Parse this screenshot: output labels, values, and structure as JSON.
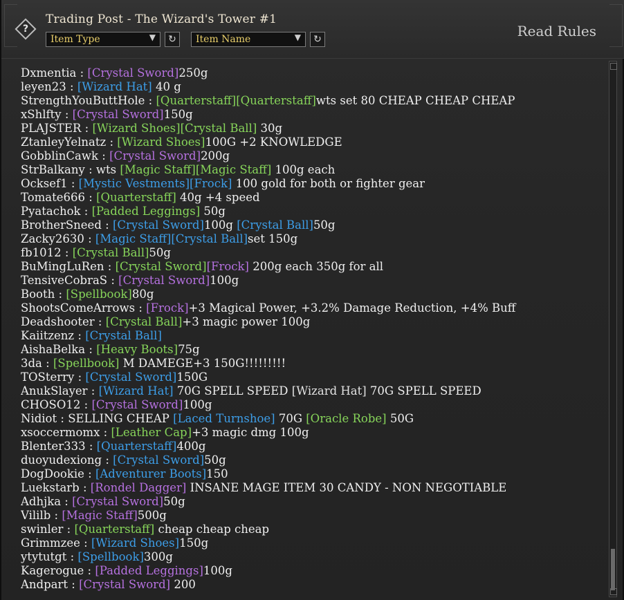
{
  "header": {
    "help_label": "?",
    "title": "Trading Post - The Wizard's Tower #1",
    "item_type_label": "Item Type",
    "item_name_label": "Item Name",
    "refresh_glyph": "↻",
    "read_rules_label": "Read Rules"
  },
  "messages": [
    {
      "segments": [
        {
          "t": "Dxmentia",
          "c": "text"
        },
        {
          "t": " : ",
          "c": "sep"
        },
        {
          "t": "[Crystal Sword]",
          "c": "epic"
        },
        {
          "t": "250g",
          "c": "text"
        }
      ]
    },
    {
      "segments": [
        {
          "t": "leyen23",
          "c": "text"
        },
        {
          "t": " : ",
          "c": "sep"
        },
        {
          "t": "[Wizard Hat]",
          "c": "rare"
        },
        {
          "t": " 40 g",
          "c": "text"
        }
      ]
    },
    {
      "segments": [
        {
          "t": "StrengthYouButtHole",
          "c": "text"
        },
        {
          "t": " : ",
          "c": "sep"
        },
        {
          "t": "[Quarterstaff][Quarterstaff]",
          "c": "uncommon"
        },
        {
          "t": "wts set 80 CHEAP CHEAP CHEAP",
          "c": "text"
        }
      ]
    },
    {
      "segments": [
        {
          "t": "xShlfty",
          "c": "text"
        },
        {
          "t": " : ",
          "c": "sep"
        },
        {
          "t": "[Crystal Sword]",
          "c": "epic"
        },
        {
          "t": "150g",
          "c": "text"
        }
      ]
    },
    {
      "segments": [
        {
          "t": "PLAJSTER",
          "c": "text"
        },
        {
          "t": " : ",
          "c": "sep"
        },
        {
          "t": "[Wizard Shoes]",
          "c": "uncommon"
        },
        {
          "t": "[Crystal Ball]",
          "c": "uncommon"
        },
        {
          "t": " 30g",
          "c": "text"
        }
      ]
    },
    {
      "segments": [
        {
          "t": "ZtanleyYelnatz",
          "c": "text"
        },
        {
          "t": " : ",
          "c": "sep"
        },
        {
          "t": "[Wizard Shoes]",
          "c": "uncommon"
        },
        {
          "t": "100G +2 KNOWLEDGE",
          "c": "text"
        }
      ]
    },
    {
      "segments": [
        {
          "t": "GobblinCawk",
          "c": "text"
        },
        {
          "t": " : ",
          "c": "sep"
        },
        {
          "t": "[Crystal Sword]",
          "c": "epic"
        },
        {
          "t": "200g",
          "c": "text"
        }
      ]
    },
    {
      "segments": [
        {
          "t": "StrBalkany",
          "c": "text"
        },
        {
          "t": " : ",
          "c": "sep"
        },
        {
          "t": "wts ",
          "c": "text"
        },
        {
          "t": "[Magic Staff]",
          "c": "uncommon"
        },
        {
          "t": "[Magic Staff]",
          "c": "uncommon"
        },
        {
          "t": " 100g each",
          "c": "text"
        }
      ]
    },
    {
      "segments": [
        {
          "t": "Ocksef1",
          "c": "text"
        },
        {
          "t": " : ",
          "c": "sep"
        },
        {
          "t": "[Mystic Vestments]",
          "c": "rare"
        },
        {
          "t": "[Frock]",
          "c": "rare"
        },
        {
          "t": " 100 gold for both or fighter gear",
          "c": "text"
        }
      ]
    },
    {
      "segments": [
        {
          "t": "Tomate666",
          "c": "text"
        },
        {
          "t": " : ",
          "c": "sep"
        },
        {
          "t": "[Quarterstaff]",
          "c": "uncommon"
        },
        {
          "t": " 40g +4 speed",
          "c": "text"
        }
      ]
    },
    {
      "segments": [
        {
          "t": "Pyatachok",
          "c": "text"
        },
        {
          "t": " : ",
          "c": "sep"
        },
        {
          "t": "[Padded Leggings]",
          "c": "uncommon"
        },
        {
          "t": " 50g",
          "c": "text"
        }
      ]
    },
    {
      "segments": [
        {
          "t": "BrotherSneed",
          "c": "text"
        },
        {
          "t": " : ",
          "c": "sep"
        },
        {
          "t": "[Crystal Sword]",
          "c": "rare"
        },
        {
          "t": "100g ",
          "c": "text"
        },
        {
          "t": "[Crystal Ball]",
          "c": "rare"
        },
        {
          "t": "50g",
          "c": "text"
        }
      ]
    },
    {
      "segments": [
        {
          "t": "Zacky2630",
          "c": "text"
        },
        {
          "t": " : ",
          "c": "sep"
        },
        {
          "t": "[Magic Staff]",
          "c": "rare"
        },
        {
          "t": "[Crystal Ball]",
          "c": "rare"
        },
        {
          "t": "set 150g",
          "c": "text"
        }
      ]
    },
    {
      "segments": [
        {
          "t": "fb1012",
          "c": "text"
        },
        {
          "t": " : ",
          "c": "sep"
        },
        {
          "t": "[Crystal Ball]",
          "c": "uncommon"
        },
        {
          "t": "50g",
          "c": "text"
        }
      ]
    },
    {
      "segments": [
        {
          "t": "BuMingLuRen",
          "c": "text"
        },
        {
          "t": " : ",
          "c": "sep"
        },
        {
          "t": "[Crystal Sword]",
          "c": "uncommon"
        },
        {
          "t": "[Frock]",
          "c": "epic"
        },
        {
          "t": " 200g each 350g for all",
          "c": "text"
        }
      ]
    },
    {
      "segments": [
        {
          "t": "TensiveCobraS",
          "c": "text"
        },
        {
          "t": " : ",
          "c": "sep"
        },
        {
          "t": "[Crystal Sword]",
          "c": "epic"
        },
        {
          "t": "100g",
          "c": "text"
        }
      ]
    },
    {
      "segments": [
        {
          "t": "Booth",
          "c": "text"
        },
        {
          "t": " : ",
          "c": "sep"
        },
        {
          "t": "[Spellbook]",
          "c": "uncommon"
        },
        {
          "t": "80g",
          "c": "text"
        }
      ]
    },
    {
      "segments": [
        {
          "t": "ShootsComeArrows",
          "c": "text"
        },
        {
          "t": " : ",
          "c": "sep"
        },
        {
          "t": "[Frock]",
          "c": "epic"
        },
        {
          "t": "+3 Magical Power, +3.2% Damage Reduction, +4% Buff",
          "c": "text"
        }
      ]
    },
    {
      "segments": [
        {
          "t": "Deadshooter",
          "c": "text"
        },
        {
          "t": " : ",
          "c": "sep"
        },
        {
          "t": "[Crystal Ball]",
          "c": "uncommon"
        },
        {
          "t": "+3 magic power 100g",
          "c": "text"
        }
      ]
    },
    {
      "segments": [
        {
          "t": "Kaiitzenz",
          "c": "text"
        },
        {
          "t": " : ",
          "c": "sep"
        },
        {
          "t": "                            ",
          "c": "text"
        },
        {
          "t": "[Crystal Ball]",
          "c": "rare"
        }
      ]
    },
    {
      "segments": [
        {
          "t": "AishaBelka",
          "c": "text"
        },
        {
          "t": " : ",
          "c": "sep"
        },
        {
          "t": "[Heavy Boots]",
          "c": "uncommon"
        },
        {
          "t": "75g",
          "c": "text"
        }
      ]
    },
    {
      "segments": [
        {
          "t": "3da",
          "c": "text"
        },
        {
          "t": " : ",
          "c": "sep"
        },
        {
          "t": "[Spellbook]",
          "c": "uncommon"
        },
        {
          "t": " M DAMEGE+3    150G!!!!!!!!!",
          "c": "text"
        }
      ]
    },
    {
      "segments": [
        {
          "t": "TOSterry",
          "c": "text"
        },
        {
          "t": " : ",
          "c": "sep"
        },
        {
          "t": "[Crystal Sword]",
          "c": "rare"
        },
        {
          "t": "150G",
          "c": "text"
        }
      ]
    },
    {
      "segments": [
        {
          "t": "AnukSlayer",
          "c": "text"
        },
        {
          "t": " : ",
          "c": "sep"
        },
        {
          "t": "[Wizard Hat]",
          "c": "rare"
        },
        {
          "t": " 70G SPELL SPEED ",
          "c": "text"
        },
        {
          "t": "[Wizard Hat]",
          "c": "common"
        },
        {
          "t": " 70G SPELL SPEED",
          "c": "text"
        }
      ]
    },
    {
      "segments": [
        {
          "t": "CHOSO12",
          "c": "text"
        },
        {
          "t": " : ",
          "c": "sep"
        },
        {
          "t": "[Crystal Sword]",
          "c": "epic"
        },
        {
          "t": "100g",
          "c": "text"
        }
      ]
    },
    {
      "segments": [
        {
          "t": "Nidiot",
          "c": "text"
        },
        {
          "t": " : ",
          "c": "sep"
        },
        {
          "t": "                    SELLING CHEAP ",
          "c": "text"
        },
        {
          "t": "[Laced Turnshoe]",
          "c": "rare"
        },
        {
          "t": " 70G ",
          "c": "text"
        },
        {
          "t": "[Oracle Robe]",
          "c": "uncommon"
        },
        {
          "t": " 50G",
          "c": "text"
        }
      ]
    },
    {
      "segments": [
        {
          "t": "xsoccermomx",
          "c": "text"
        },
        {
          "t": " : ",
          "c": "sep"
        },
        {
          "t": "[Leather Cap]",
          "c": "uncommon"
        },
        {
          "t": "+3 magic dmg 100g",
          "c": "text"
        }
      ]
    },
    {
      "segments": [
        {
          "t": "Blenter333",
          "c": "text"
        },
        {
          "t": " : ",
          "c": "sep"
        },
        {
          "t": "[Quarterstaff]",
          "c": "rare"
        },
        {
          "t": "400g",
          "c": "text"
        }
      ]
    },
    {
      "segments": [
        {
          "t": "duoyudexiong",
          "c": "text"
        },
        {
          "t": " : ",
          "c": "sep"
        },
        {
          "t": "                                         ",
          "c": "text"
        },
        {
          "t": "[Crystal Sword]",
          "c": "rare"
        },
        {
          "t": "50g",
          "c": "text"
        }
      ]
    },
    {
      "segments": [
        {
          "t": "DogDookie",
          "c": "text"
        },
        {
          "t": " : ",
          "c": "sep"
        },
        {
          "t": "[Adventurer Boots]",
          "c": "rare"
        },
        {
          "t": "150",
          "c": "text"
        }
      ]
    },
    {
      "segments": [
        {
          "t": "Luekstarb",
          "c": "text"
        },
        {
          "t": " : ",
          "c": "sep"
        },
        {
          "t": "[Rondel Dagger]",
          "c": "epic"
        },
        {
          "t": " INSANE MAGE ITEM 30 CANDY - NON NEGOTIABLE",
          "c": "text"
        }
      ]
    },
    {
      "segments": [
        {
          "t": "Adhjka",
          "c": "text"
        },
        {
          "t": " : ",
          "c": "sep"
        },
        {
          "t": "[Crystal Sword]",
          "c": "epic"
        },
        {
          "t": "50g",
          "c": "text"
        }
      ]
    },
    {
      "segments": [
        {
          "t": "Vililb",
          "c": "text"
        },
        {
          "t": " : ",
          "c": "sep"
        },
        {
          "t": "[Magic Staff]",
          "c": "epic"
        },
        {
          "t": "500g",
          "c": "text"
        }
      ]
    },
    {
      "segments": [
        {
          "t": "swinler",
          "c": "text"
        },
        {
          "t": " : ",
          "c": "sep"
        },
        {
          "t": "[Quarterstaff]",
          "c": "uncommon"
        },
        {
          "t": " cheap cheap cheap",
          "c": "text"
        }
      ]
    },
    {
      "segments": [
        {
          "t": "Grimmzee",
          "c": "text"
        },
        {
          "t": " : ",
          "c": "sep"
        },
        {
          "t": "[Wizard Shoes]",
          "c": "rare"
        },
        {
          "t": "150g",
          "c": "text"
        }
      ]
    },
    {
      "segments": [
        {
          "t": "ytytutgt",
          "c": "text"
        },
        {
          "t": " : ",
          "c": "sep"
        },
        {
          "t": "[Spellbook]",
          "c": "rare"
        },
        {
          "t": "300g",
          "c": "text"
        }
      ]
    },
    {
      "segments": [
        {
          "t": "Kagerogue",
          "c": "text"
        },
        {
          "t": " : ",
          "c": "sep"
        },
        {
          "t": "[Padded Leggings]",
          "c": "epic"
        },
        {
          "t": "100g",
          "c": "text"
        }
      ]
    },
    {
      "segments": [
        {
          "t": "Andpart",
          "c": "text"
        },
        {
          "t": " : ",
          "c": "sep"
        },
        {
          "t": "[Crystal Sword]",
          "c": "epic"
        },
        {
          "t": " 200",
          "c": "text"
        }
      ]
    }
  ],
  "colors": {
    "common": "#e3e3e3",
    "uncommon": "#87d55a",
    "rare": "#3d9ee8",
    "epic": "#b671e0",
    "text": "#efefef"
  },
  "icons": {
    "help": "help-diamond-icon",
    "dropdown": "chevron-down-icon",
    "refresh": "refresh-icon"
  }
}
